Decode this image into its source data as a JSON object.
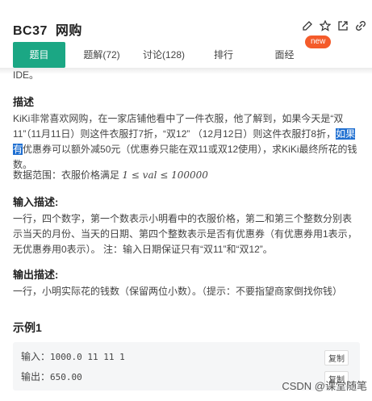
{
  "header": {
    "code": "BC37",
    "name": "网购",
    "new_badge": "new",
    "icons": [
      "edit-icon",
      "star-icon",
      "share-icon",
      "link-icon"
    ]
  },
  "tabs": [
    {
      "label": "题目"
    },
    {
      "label": "题解(72)"
    },
    {
      "label": "讨论(128)"
    },
    {
      "label": "排行"
    },
    {
      "label": "面经"
    }
  ],
  "top_text": "IDE。",
  "description": {
    "title": "描述",
    "para_part1": "KiKi非常喜欢网购，在一家店铺他看中了一件衣服，他了解到，如果今天是“双11”（11月11日）则这件衣服打7折，“双12” （12月12日）则这件衣服打8折，",
    "para_highlight": "如果有",
    "para_part2": "优惠券可以额外减50元（优惠券只能在双11或双12使用），求KiKi最终所花的钱数。",
    "range_label": "数据范围：衣服价格满足",
    "range_formula": "1 ≤ val ≤ 100000"
  },
  "input_desc": {
    "title": "输入描述:",
    "text": "一行，四个数字，第一个数表示小明看中的衣服价格，第二和第三个整数分别表示当天的月份、当天的日期、第四个整数表示是否有优惠券（有优惠券用1表示，无优惠券用0表示）。 注：输入日期保证只有“双11”和“双12”。"
  },
  "output_desc": {
    "title": "输出描述:",
    "text": "一行，小明实际花的钱数（保留两位小数）。（提示：不要指望商家倒找你钱）"
  },
  "example": {
    "title": "示例1",
    "input_label": "输入：",
    "input_value": "1000.0 11 11 1",
    "output_label": "输出：",
    "output_value": "650.00",
    "copy_label": "复制"
  },
  "watermark": "CSDN @课堂随笔"
}
